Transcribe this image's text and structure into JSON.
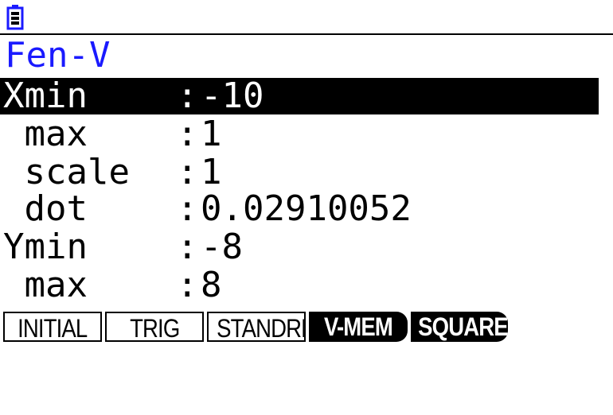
{
  "screen": {
    "title": "Fen-V",
    "rows": [
      {
        "label": "Xmin",
        "value": "-10",
        "selected": true
      },
      {
        "label": " max",
        "value": "1"
      },
      {
        "label": " scale",
        "value": "1"
      },
      {
        "label": " dot",
        "value": "0.02910052"
      },
      {
        "label": "Ymin",
        "value": "-8"
      },
      {
        "label": " max",
        "value": "8"
      }
    ]
  },
  "fkeys": [
    {
      "label": "INITIAL",
      "style": "outlined"
    },
    {
      "label": "TRIG",
      "style": "outlined"
    },
    {
      "label": "STANDRD",
      "style": "outlined"
    },
    {
      "label": "V-MEM",
      "style": "filled"
    },
    {
      "label": "SQUARE",
      "style": "filled"
    }
  ],
  "colors": {
    "title": "#1a1aff",
    "selection_bg": "#000000",
    "background": "#ffffff"
  },
  "icons": {
    "status": "battery-icon"
  }
}
